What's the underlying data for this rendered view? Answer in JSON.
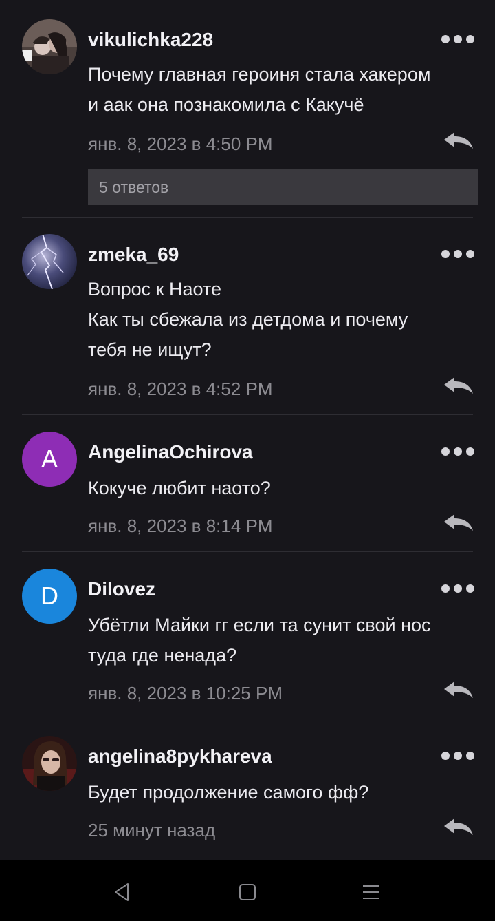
{
  "comments": [
    {
      "username": "vikulichka228",
      "text": "Почему главная героиня стала  хакером\nи аак она познакомила с Какучё",
      "time": "янв. 8, 2023 в 4:50 PM",
      "replies": "5 ответов",
      "avatar_type": "photo"
    },
    {
      "username": "zmeka_69",
      "text": "Вопрос к Наоте\nКак ты сбежала из детдома и почему\nтебя не ищут?",
      "time": "янв. 8, 2023 в 4:52 PM",
      "avatar_type": "photo"
    },
    {
      "username": "AngelinaOchirova",
      "text": "Кокуче любит наото?",
      "time": "янв. 8, 2023 в 8:14 PM",
      "avatar_letter": "A",
      "avatar_color": "#8e2db5"
    },
    {
      "username": "Dilovez",
      "text": "Убётли Майки гг если та сунит свой нос\nтуда где ненада?",
      "time": "янв. 8, 2023 в 10:25 PM",
      "avatar_letter": "D",
      "avatar_color": "#1a86dc"
    },
    {
      "username": "angelina8pykhareva",
      "text": "Будет продолжение самого фф?",
      "time": "25 минут назад",
      "avatar_type": "photo"
    }
  ],
  "icons": {
    "menu": "more-dots-icon",
    "reply": "reply-arrow-icon",
    "nav_back": "back-triangle-icon",
    "nav_home": "home-square-icon",
    "nav_recents": "menu-lines-icon"
  }
}
